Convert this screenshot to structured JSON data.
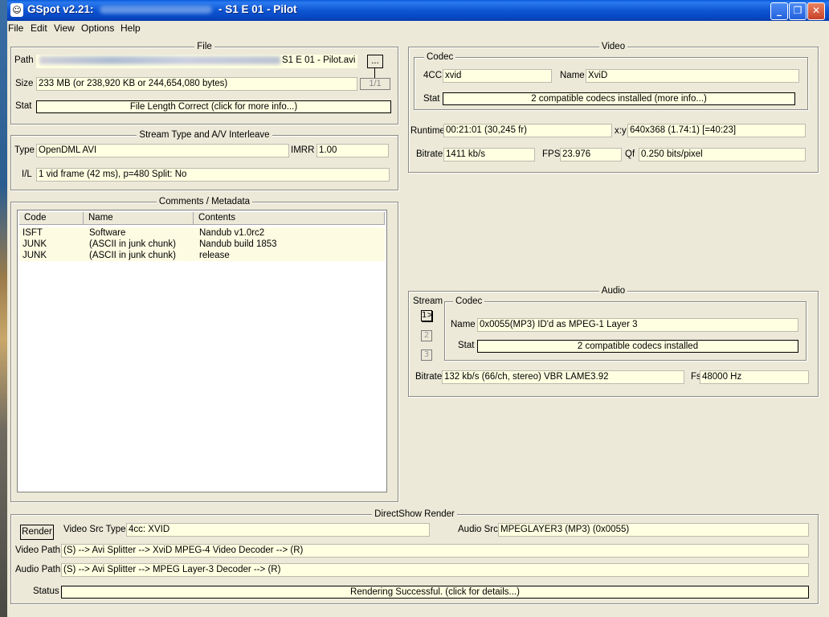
{
  "window": {
    "title_prefix": "GSpot v2.21: ",
    "title_suffix": " - S1 E 01 - Pilot",
    "controls": {
      "minimize": "_",
      "maximize": "❐",
      "close": "✕"
    },
    "app_icon": "gspot-face-icon"
  },
  "menu": [
    "File",
    "Edit",
    "View",
    "Options",
    "Help"
  ],
  "file": {
    "title": "File",
    "path_label": "Path",
    "path_value_suffix": "S1 E 01 - Pilot.avi",
    "browse_label": "...",
    "page_indicator": "1/1",
    "size_label": "Size",
    "size_value": "233 MB (or 238,920 KB or 244,654,080 bytes)",
    "stat_label": "Stat",
    "stat_value": "File Length Correct (click for more info...)"
  },
  "stream": {
    "title": "Stream Type and A/V Interleave",
    "type_label": "Type",
    "type_value": "OpenDML AVI",
    "imrr_label": "IMRR",
    "imrr_value": "1.00",
    "il_label": "I/L",
    "il_value": "1 vid frame (42 ms), p=480  Split: No"
  },
  "comments": {
    "title": "Comments / Metadata",
    "columns": [
      "Code",
      "Name",
      "Contents"
    ],
    "rows": [
      {
        "code": "ISFT",
        "name": "Software",
        "contents": "Nandub v1.0rc2"
      },
      {
        "code": "JUNK",
        "name": "(ASCII in junk chunk)",
        "contents": "Nandub build 1853"
      },
      {
        "code": "JUNK",
        "name": "(ASCII in junk chunk)",
        "contents": "release"
      }
    ]
  },
  "video": {
    "title": "Video",
    "codec_title": "Codec",
    "fourcc_label": "4CC",
    "fourcc_value": "xvid",
    "name_label": "Name",
    "name_value": "XviD",
    "stat_label": "Stat",
    "stat_value": "2 compatible codecs installed (more info...)",
    "runtime_label": "Runtime",
    "runtime_value": "00:21:01 (30,245 fr)",
    "xy_label": "x:y",
    "xy_value": "640x368 (1.74:1) [=40:23]",
    "bitrate_label": "Bitrate",
    "bitrate_value": "1411 kb/s",
    "fps_label": "FPS",
    "fps_value": "23.976",
    "qf_label": "Qf",
    "qf_value": "0.250 bits/pixel"
  },
  "audio": {
    "title": "Audio",
    "stream_label": "Stream",
    "stream_buttons": [
      "1>",
      "2",
      "3"
    ],
    "codec_title": "Codec",
    "name_label": "Name",
    "name_value": "0x0055(MP3) ID'd as MPEG-1 Layer 3",
    "stat_label": "Stat",
    "stat_value": "2 compatible codecs installed",
    "bitrate_label": "Bitrate",
    "bitrate_value": "132 kb/s (66/ch, stereo) VBR LAME3.92",
    "fs_label": "Fs",
    "fs_value": "48000 Hz"
  },
  "directshow": {
    "title": "DirectShow Render",
    "render_button": "Render",
    "video_src_label": "Video Src Type",
    "video_src_value": "4cc: XVID",
    "audio_src_label": "Audio Src",
    "audio_src_value": "MPEGLAYER3 (MP3) (0x0055)",
    "video_path_label": "Video Path",
    "video_path_value": "(S) --> Avi Splitter --> XviD MPEG-4 Video Decoder --> (R)",
    "audio_path_label": "Audio Path",
    "audio_path_value": "(S) --> Avi Splitter --> MPEG Layer-3 Decoder --> (R)",
    "status_label": "Status",
    "status_value": "Rendering Successful.  (click for details...)"
  }
}
